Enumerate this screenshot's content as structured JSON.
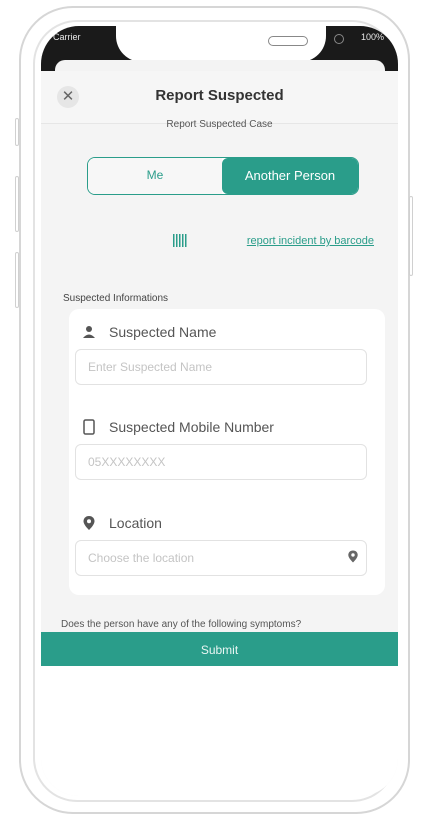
{
  "status_bar": {
    "carrier": "Carrier",
    "battery": "100%"
  },
  "modal": {
    "title": "Report Suspected",
    "subtitle": "Report Suspected Case",
    "segment": {
      "me": "Me",
      "another": "Another Person",
      "selected": "Another Person"
    },
    "barcode_link": "report incident by barcode",
    "section_label": "Suspected Informations",
    "fields": {
      "name": {
        "label": "Suspected Name",
        "placeholder": "Enter Suspected Name"
      },
      "mobile": {
        "label": "Suspected Mobile Number",
        "placeholder": "05XXXXXXXX"
      },
      "location": {
        "label": "Location",
        "placeholder": "Choose the location"
      }
    },
    "symptoms_question": "Does the person have any of the following symptoms?",
    "submit_label": "Submit"
  },
  "colors": {
    "accent": "#2a9d8a"
  }
}
